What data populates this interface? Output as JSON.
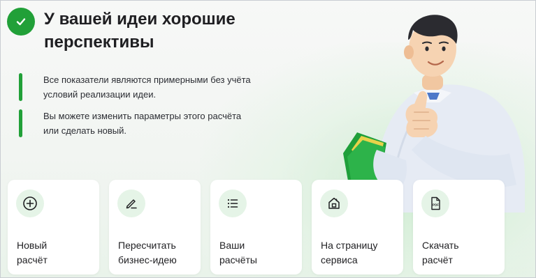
{
  "header": {
    "title_line1": "У вашей идеи хорошие",
    "title_line2": "перспективы"
  },
  "notes": [
    {
      "line1": "Все показатели являются примерными без учёта",
      "line2": "условий реализации идеи."
    },
    {
      "line1": "Вы можете изменить параметры этого расчёта",
      "line2": "или сделать новый."
    }
  ],
  "actions": [
    {
      "line1": "Новый",
      "line2": "расчёт",
      "icon": "plus-circle-icon"
    },
    {
      "line1": "Пересчитать",
      "line2": "бизнес-идею",
      "icon": "pencil-icon"
    },
    {
      "line1": "Ваши",
      "line2": "расчёты",
      "icon": "list-icon"
    },
    {
      "line1": "На страницу",
      "line2": "сервиса",
      "icon": "home-icon"
    },
    {
      "line1": "Скачать",
      "line2": "расчёт",
      "icon": "pdf-icon"
    }
  ],
  "colors": {
    "accent": "#21a038",
    "icon_bg": "#e5f4e7",
    "text": "#1f1f22"
  }
}
